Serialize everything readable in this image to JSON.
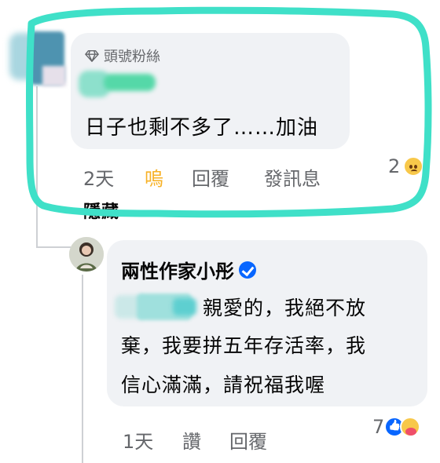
{
  "comment": {
    "badge": "頭號粉絲",
    "text": "日子也剩不多了……加油",
    "time": "2天",
    "react_label": "嗚",
    "reply_label": "回覆",
    "message_label": "發訊息",
    "reaction_count": "2",
    "reaction_icon": "sad-emoji",
    "hidden_label": "隱藏",
    "highlight_color": "#3fe0c8"
  },
  "reply": {
    "author": "兩性作家小彤",
    "verified": true,
    "text_line1": "親愛的，我絕不放",
    "text_line2": "棄，我要拼五年存活率，我",
    "text_line3": "信心滿滿，請祝福我喔",
    "time": "1天",
    "like_label": "讚",
    "reply_label": "回覆",
    "reaction_count": "7",
    "reaction_icons": [
      "like-emoji",
      "care-emoji"
    ],
    "accent_color": "#0866ff"
  }
}
